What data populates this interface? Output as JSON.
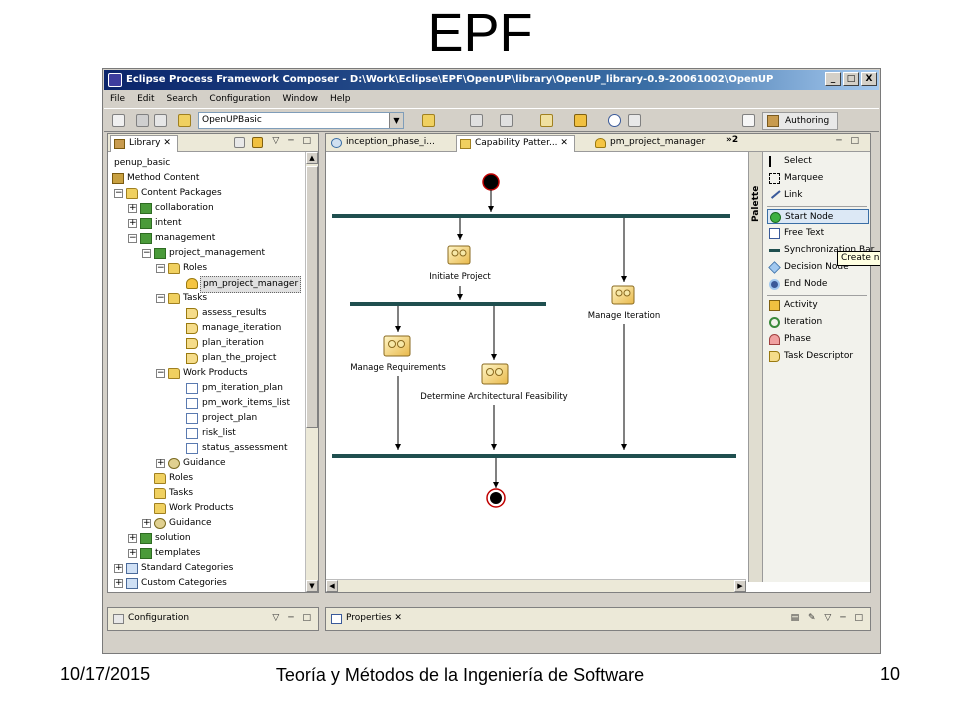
{
  "slide": {
    "title": "EPF",
    "footer_date": "10/17/2015",
    "footer_center": "Teoría y Métodos de la Ingeniería de Software",
    "page_number": "10"
  },
  "window": {
    "title": "Eclipse Process Framework Composer - D:\\Work\\Eclipse\\EPF\\OpenUP\\library\\OpenUP_library-0.9-20061002\\OpenUP",
    "minimize": "_",
    "maximize": "□",
    "close": "X"
  },
  "menu": [
    "File",
    "Edit",
    "Search",
    "Configuration",
    "Window",
    "Help"
  ],
  "toolbar": {
    "configuration_value": "OpenUPBasic",
    "perspective_label": "Authoring"
  },
  "library_panel": {
    "tab_label": "Library",
    "tree": [
      {
        "label": "penup_basic",
        "icon": "library-icon"
      },
      {
        "label": "Method Content",
        "icon": "library-icon"
      },
      {
        "label": "Content Packages",
        "icon": "folder-icon"
      },
      {
        "label": "collaboration",
        "icon": "package-icon"
      },
      {
        "label": "intent",
        "icon": "package-icon"
      },
      {
        "label": "management",
        "icon": "package-icon"
      },
      {
        "label": "project_management",
        "icon": "package-icon"
      },
      {
        "label": "Roles",
        "icon": "folder-icon"
      },
      {
        "label": "pm_project_manager",
        "icon": "role-icon"
      },
      {
        "label": "Tasks",
        "icon": "folder-icon"
      },
      {
        "label": "assess_results",
        "icon": "task-icon"
      },
      {
        "label": "manage_iteration",
        "icon": "task-icon"
      },
      {
        "label": "plan_iteration",
        "icon": "task-icon"
      },
      {
        "label": "plan_the_project",
        "icon": "task-icon"
      },
      {
        "label": "Work Products",
        "icon": "folder-icon"
      },
      {
        "label": "pm_iteration_plan",
        "icon": "work-product-icon"
      },
      {
        "label": "pm_work_items_list",
        "icon": "work-product-icon"
      },
      {
        "label": "project_plan",
        "icon": "work-product-icon"
      },
      {
        "label": "risk_list",
        "icon": "work-product-icon"
      },
      {
        "label": "status_assessment",
        "icon": "work-product-icon"
      },
      {
        "label": "Guidance",
        "icon": "guidance-icon"
      },
      {
        "label": "Roles",
        "icon": "folder-icon"
      },
      {
        "label": "Tasks",
        "icon": "folder-icon"
      },
      {
        "label": "Work Products",
        "icon": "folder-icon"
      },
      {
        "label": "Guidance",
        "icon": "guidance-icon"
      },
      {
        "label": "solution",
        "icon": "package-icon"
      },
      {
        "label": "templates",
        "icon": "package-icon"
      },
      {
        "label": "Standard Categories",
        "icon": "category-icon"
      },
      {
        "label": "Custom Categories",
        "icon": "category-icon"
      }
    ]
  },
  "editor": {
    "tabs": [
      "inception_phase_i...",
      "Capability Patter...",
      "pm_project_manager"
    ],
    "overflow_count": "2",
    "nodes": {
      "initiate": "Initiate Project",
      "manage_iteration": "Manage Iteration",
      "manage_requirements": "Manage Requirements",
      "determine_architecture": "Determine Architectural Feasibility"
    }
  },
  "palette": {
    "label": "Palette",
    "items": [
      "Select",
      "Marquee",
      "Link",
      "Start Node",
      "Free Text",
      "Synchronization Bar",
      "Decision Node",
      "End Node",
      "Activity",
      "Iteration",
      "Phase",
      "Task Descriptor"
    ],
    "tooltip": "Create ne"
  },
  "bottom": {
    "configuration_tab": "Configuration",
    "properties_tab": "Properties"
  },
  "colors": {
    "titlebar": "#0a246a",
    "sync_bar": "#1f4f4f",
    "chrome": "#d4d0c8"
  }
}
